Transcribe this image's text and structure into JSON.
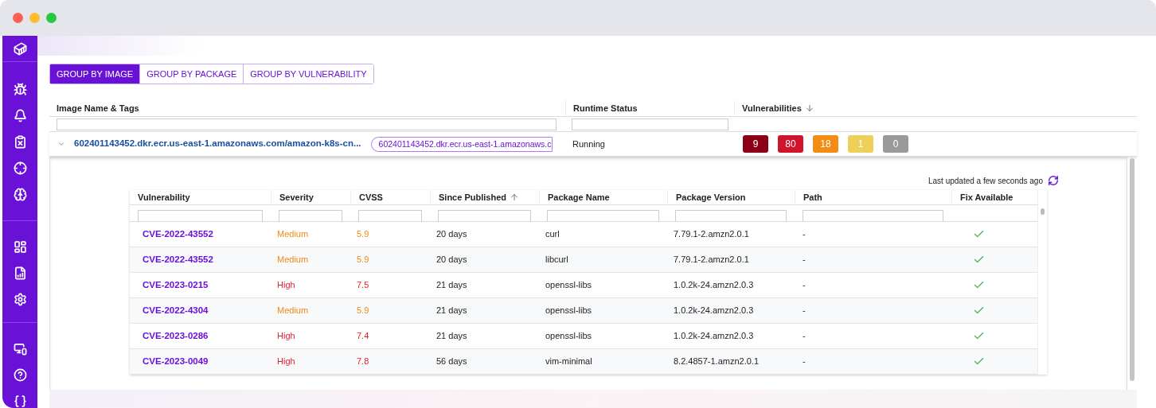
{
  "group_tabs": [
    {
      "label": "GROUP BY IMAGE",
      "selected": true
    },
    {
      "label": "GROUP BY PACKAGE",
      "selected": false
    },
    {
      "label": "GROUP BY VULNERABILITY",
      "selected": false
    }
  ],
  "images_table": {
    "columns": [
      {
        "label": "Image Name & Tags"
      },
      {
        "label": "Runtime Status"
      },
      {
        "label": "Vulnerabilities",
        "sorted_descending": true
      }
    ],
    "rows": [
      {
        "expanded": true,
        "name": "602401143452.dkr.ecr.us-east-1.amazonaws.com/amazon-k8s-cn...",
        "tag": "602401143452.dkr.ecr.us-east-1.amazonaws.c",
        "status": "Running",
        "badges": [
          {
            "count": "9",
            "color": "#8b0017"
          },
          {
            "count": "80",
            "color": "#d0142c"
          },
          {
            "count": "18",
            "color": "#f28c13"
          },
          {
            "count": "1",
            "color": "#ecd05a"
          },
          {
            "count": "0",
            "color": "#9a9a9a"
          }
        ],
        "details": {
          "last_updated": "Last updated a few seconds ago",
          "columns": [
            {
              "label": "Vulnerability",
              "filter": true
            },
            {
              "label": "Severity",
              "filter": true
            },
            {
              "label": "CVSS",
              "filter": true
            },
            {
              "label": "Since Published",
              "sorted_ascending": true,
              "filter": true
            },
            {
              "label": "Package Name",
              "filter": true
            },
            {
              "label": "Package Version",
              "filter": true
            },
            {
              "label": "Path",
              "filter": true
            },
            {
              "label": "Fix Available",
              "filter": false
            }
          ],
          "rows": [
            {
              "id": "CVE-2022-43552",
              "severity": "Medium",
              "kind": "medium",
              "cvss": "5.9",
              "since": "20 days",
              "package": "curl",
              "version": "7.79.1-2.amzn2.0.1",
              "path": "-",
              "fix_available": true
            },
            {
              "id": "CVE-2022-43552",
              "severity": "Medium",
              "kind": "medium",
              "cvss": "5.9",
              "since": "20 days",
              "package": "libcurl",
              "version": "7.79.1-2.amzn2.0.1",
              "path": "-",
              "fix_available": true
            },
            {
              "id": "CVE-2023-0215",
              "severity": "High",
              "kind": "high",
              "cvss": "7.5",
              "since": "21 days",
              "package": "openssl-libs",
              "version": "1.0.2k-24.amzn2.0.3",
              "path": "-",
              "fix_available": true
            },
            {
              "id": "CVE-2022-4304",
              "severity": "Medium",
              "kind": "medium",
              "cvss": "5.9",
              "since": "21 days",
              "package": "openssl-libs",
              "version": "1.0.2k-24.amzn2.0.3",
              "path": "-",
              "fix_available": true
            },
            {
              "id": "CVE-2023-0286",
              "severity": "High",
              "kind": "high",
              "cvss": "7.4",
              "since": "21 days",
              "package": "openssl-libs",
              "version": "1.0.2k-24.amzn2.0.3",
              "path": "-",
              "fix_available": true
            },
            {
              "id": "CVE-2023-0049",
              "severity": "High",
              "kind": "high",
              "cvss": "7.8",
              "since": "56 days",
              "package": "vim-minimal",
              "version": "8.2.4857-1.amzn2.0.1",
              "path": "-",
              "fix_available": true
            }
          ]
        }
      }
    ]
  }
}
